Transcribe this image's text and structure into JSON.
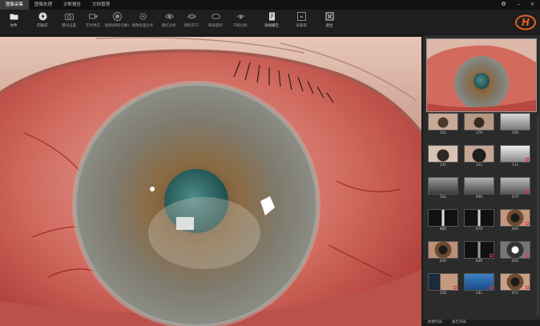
{
  "menu": {
    "tabs": [
      "图像采集",
      "图像处理",
      "诊断报告",
      "文档管理"
    ]
  },
  "toolbar": {
    "tools": [
      "文件",
      "闪光灯",
      "曝光设置",
      "实时预览",
      "视频录制(切换)",
      "图像处理分析",
      "眼红分析",
      "眼睑开口",
      "眼表面积",
      "干眼分析",
      "添加报告",
      "采集器",
      "退出"
    ]
  },
  "brand": {
    "logo_text": "H"
  },
  "thumbnails": {
    "labels": [
      "10L",
      "17R",
      "15R",
      "14L",
      "12L",
      "11L",
      "10L",
      "09R",
      "07R",
      "08R",
      "07R",
      "04R",
      "03R",
      "04R",
      "05R",
      "15R",
      "14L",
      "07L"
    ]
  },
  "side_tabs": [
    "图像列表",
    "报告列表"
  ],
  "colors": {
    "accent": "#e0621f",
    "sclera": "#c9524a",
    "iris": "#7d7868",
    "pupil": "#2f6e6a",
    "panel": "#2b2b2b"
  }
}
